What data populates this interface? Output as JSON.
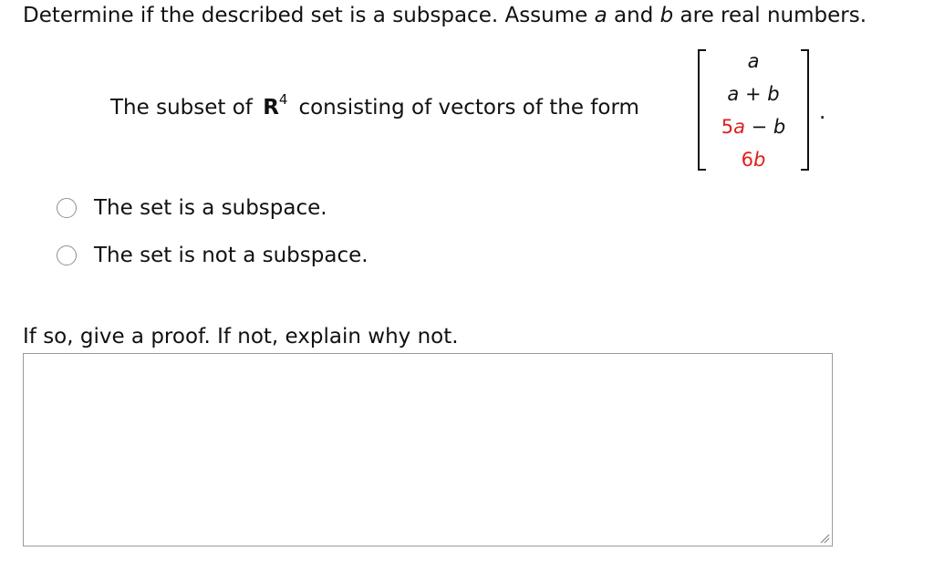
{
  "question": {
    "part1": "Determine if the described set is a subspace. Assume ",
    "var_a": "a",
    "part2": " and ",
    "var_b": "b",
    "part3": " are real numbers."
  },
  "form": {
    "text_before": "The subset of",
    "space": "R",
    "dimension": "4",
    "text_after": "consisting of vectors of the form"
  },
  "vector": {
    "row1": "a",
    "row2": {
      "a": "a",
      "op": " + ",
      "b": "b"
    },
    "row3": {
      "coef": "5",
      "a": "a",
      "op": " − ",
      "b": "b"
    },
    "row4": {
      "coef": "6",
      "b": "b"
    },
    "highlight_color": "#e0201b",
    "terminal": "."
  },
  "options": [
    {
      "label": "The set is a subspace.",
      "selected": false
    },
    {
      "label": "The set is not a subspace.",
      "selected": false
    }
  ],
  "answer": {
    "prompt": "If so, give a proof. If not, explain why not.",
    "value": ""
  }
}
